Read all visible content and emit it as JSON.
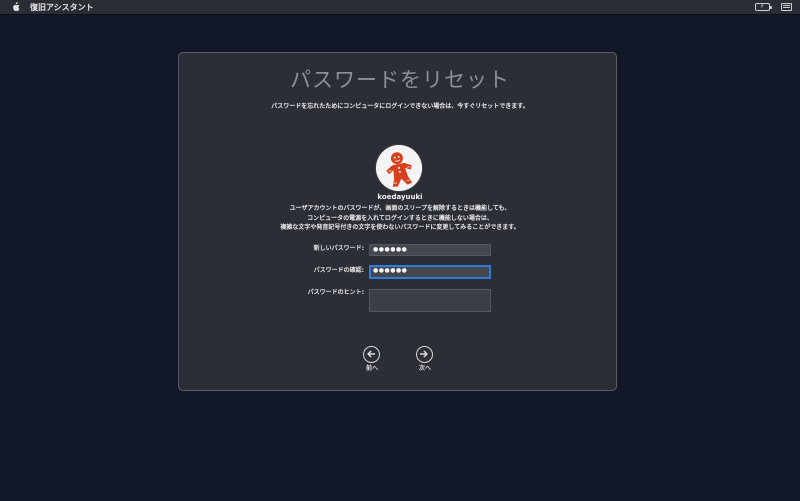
{
  "menubar": {
    "app_title": "復旧アシスタント",
    "icons": [
      "apple-icon",
      "battery-icon",
      "keyboard-icon"
    ]
  },
  "dialog": {
    "title": "パスワードをリセット",
    "subtitle": "パスワードを忘れたためにコンピュータにログインできない場合は、今すぐリセットできます。",
    "user": {
      "name": "koedayuuki",
      "avatar_icon": "gingerbread-man-icon"
    },
    "description": [
      "ユーザアカウントのパスワードが、画面のスリープを解除するときは機能しても、",
      "コンピュータの電源を入れてログインするときに機能しない場合は、",
      "複雑な文字や発音記号付きの文字を使わないパスワードに変更してみることができます。"
    ],
    "fields": {
      "new_password": {
        "label": "新しいパスワード:",
        "value": "●●●●●●"
      },
      "verify_password": {
        "label": "パスワードの確認:",
        "value": "●●●●●●"
      },
      "hint": {
        "label": "パスワードのヒント:",
        "value": ""
      }
    },
    "nav": {
      "back_label": "前へ",
      "next_label": "次へ"
    }
  },
  "colors": {
    "background": "#121827",
    "panel": "#2c2e36",
    "focus_ring": "#2f7ce0",
    "title_text": "#8d9097"
  }
}
